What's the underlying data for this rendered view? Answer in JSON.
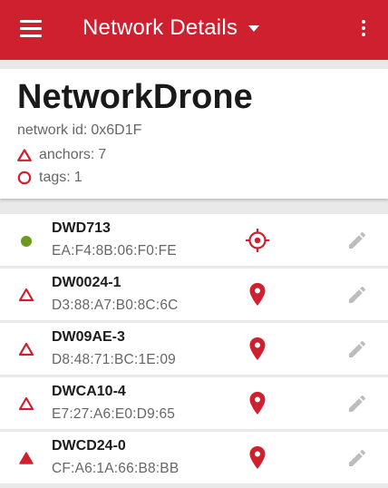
{
  "app_bar": {
    "title": "Network Details",
    "menu_icon": "hamburger-menu-icon",
    "dropdown_icon": "caret-down-icon",
    "overflow_icon": "more-vert-icon"
  },
  "network": {
    "name": "NetworkDrone",
    "id_label": "network id:",
    "id_value": "0x6D1F",
    "anchors_label": "anchors:",
    "anchors_count": "7",
    "tags_label": "tags:",
    "tags_count": "1"
  },
  "colors": {
    "brand_red": "#cf2030",
    "tag_green": "#6b9a1f",
    "muted_gray": "#bdbdbd",
    "text_dark": "#1c1c1c",
    "text_muted": "#666666"
  },
  "nodes": [
    {
      "name": "DWD713",
      "mac": "EA:F4:8B:06:F0:FE",
      "type": "tag",
      "type_icon": "green-dot-icon",
      "location_icon": "crosshair-icon"
    },
    {
      "name": "DW0024-1",
      "mac": "D3:88:A7:B0:8C:6C",
      "type": "anchor",
      "type_icon": "triangle-outline-icon",
      "location_icon": "map-pin-icon"
    },
    {
      "name": "DW09AE-3",
      "mac": "D8:48:71:BC:1E:09",
      "type": "anchor",
      "type_icon": "triangle-outline-icon",
      "location_icon": "map-pin-icon"
    },
    {
      "name": "DWCA10-4",
      "mac": "E7:27:A6:E0:D9:65",
      "type": "anchor",
      "type_icon": "triangle-outline-icon",
      "location_icon": "map-pin-icon"
    },
    {
      "name": "DWCD24-0",
      "mac": "CF:A6:1A:66:B8:BB",
      "type": "anchor",
      "type_icon": "triangle-filled-icon",
      "location_icon": "map-pin-icon"
    }
  ]
}
